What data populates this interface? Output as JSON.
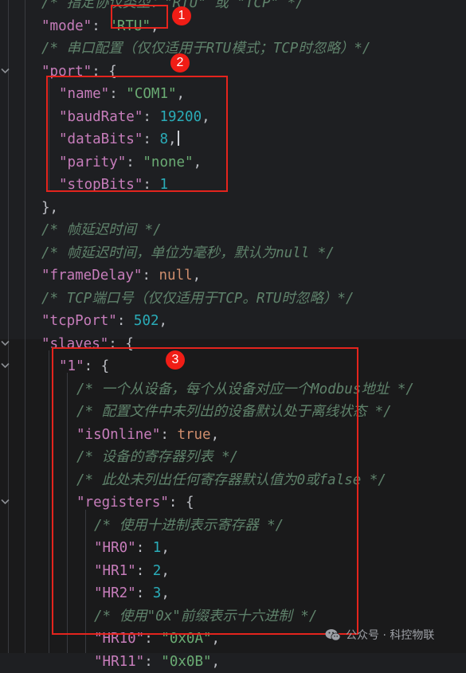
{
  "editor": {
    "lines": [
      {
        "indent": 2,
        "tokens": [
          {
            "t": "cm",
            "v": "/* 指定协议类型：\"RTU\" 或 \"TCP\" */"
          }
        ]
      },
      {
        "indent": 2,
        "tokens": [
          {
            "t": "key",
            "v": "\"mode\""
          },
          {
            "t": "p",
            "v": ": "
          },
          {
            "t": "str",
            "v": "\"RTU\""
          },
          {
            "t": "p",
            "v": ","
          }
        ]
      },
      {
        "indent": 2,
        "tokens": [
          {
            "t": "cm",
            "v": "/* 串口配置（仅仅适用于RTU模式；TCP时忽略）*/"
          }
        ]
      },
      {
        "indent": 2,
        "fold": true,
        "tokens": [
          {
            "t": "key",
            "v": "\"port\""
          },
          {
            "t": "p",
            "v": ": {"
          }
        ]
      },
      {
        "indent": 3,
        "tokens": [
          {
            "t": "key",
            "v": "\"name\""
          },
          {
            "t": "p",
            "v": ": "
          },
          {
            "t": "str",
            "v": "\"COM1\""
          },
          {
            "t": "p",
            "v": ","
          }
        ]
      },
      {
        "indent": 3,
        "tokens": [
          {
            "t": "key",
            "v": "\"baudRate\""
          },
          {
            "t": "p",
            "v": ": "
          },
          {
            "t": "num",
            "v": "19200"
          },
          {
            "t": "p",
            "v": ","
          }
        ]
      },
      {
        "indent": 3,
        "caret": true,
        "tokens": [
          {
            "t": "key",
            "v": "\"dataBits\""
          },
          {
            "t": "p",
            "v": ": "
          },
          {
            "t": "num",
            "v": "8"
          },
          {
            "t": "p",
            "v": ","
          }
        ]
      },
      {
        "indent": 3,
        "tokens": [
          {
            "t": "key",
            "v": "\"parity\""
          },
          {
            "t": "p",
            "v": ": "
          },
          {
            "t": "str",
            "v": "\"none\""
          },
          {
            "t": "p",
            "v": ","
          }
        ]
      },
      {
        "indent": 3,
        "tokens": [
          {
            "t": "key",
            "v": "\"stopBits\""
          },
          {
            "t": "p",
            "v": ": "
          },
          {
            "t": "num",
            "v": "1"
          }
        ]
      },
      {
        "indent": 2,
        "tokens": [
          {
            "t": "p",
            "v": "},"
          }
        ]
      },
      {
        "indent": 2,
        "tokens": [
          {
            "t": "cm",
            "v": "/* 帧延迟时间 */"
          }
        ]
      },
      {
        "indent": 2,
        "tokens": [
          {
            "t": "cm",
            "v": "/* 帧延迟时间，单位为毫秒，默认为null */"
          }
        ]
      },
      {
        "indent": 2,
        "tokens": [
          {
            "t": "key",
            "v": "\"frameDelay\""
          },
          {
            "t": "p",
            "v": ": "
          },
          {
            "t": "kw",
            "v": "null"
          },
          {
            "t": "p",
            "v": ","
          }
        ]
      },
      {
        "indent": 2,
        "tokens": [
          {
            "t": "cm",
            "v": "/* TCP端口号（仅仅适用于TCP。RTU时忽略）*/"
          }
        ]
      },
      {
        "indent": 2,
        "tokens": [
          {
            "t": "key",
            "v": "\"tcpPort\""
          },
          {
            "t": "p",
            "v": ": "
          },
          {
            "t": "num",
            "v": "502"
          },
          {
            "t": "p",
            "v": ","
          }
        ]
      },
      {
        "indent": 2,
        "fold": true,
        "tokens": [
          {
            "t": "key",
            "v": "\"slaves\""
          },
          {
            "t": "p",
            "v": ": {"
          }
        ]
      },
      {
        "indent": 3,
        "fold": true,
        "tokens": [
          {
            "t": "key",
            "v": "\"1\""
          },
          {
            "t": "p",
            "v": ": {"
          }
        ]
      },
      {
        "indent": 4,
        "tokens": [
          {
            "t": "cm",
            "v": "/* 一个从设备，每个从设备对应一个Modbus地址 */"
          }
        ]
      },
      {
        "indent": 4,
        "tokens": [
          {
            "t": "cm",
            "v": "/* 配置文件中未列出的设备默认处于离线状态 */"
          }
        ]
      },
      {
        "indent": 4,
        "tokens": [
          {
            "t": "key",
            "v": "\"isOnline\""
          },
          {
            "t": "p",
            "v": ": "
          },
          {
            "t": "kw",
            "v": "true"
          },
          {
            "t": "p",
            "v": ","
          }
        ]
      },
      {
        "indent": 4,
        "tokens": [
          {
            "t": "cm",
            "v": "/* 设备的寄存器列表 */"
          }
        ]
      },
      {
        "indent": 4,
        "tokens": [
          {
            "t": "cm",
            "v": "/* 此处未列出任何寄存器默认值为0或false */"
          }
        ]
      },
      {
        "indent": 4,
        "fold": true,
        "tokens": [
          {
            "t": "key",
            "v": "\"registers\""
          },
          {
            "t": "p",
            "v": ": {"
          }
        ]
      },
      {
        "indent": 5,
        "tokens": [
          {
            "t": "cm",
            "v": "/* 使用十进制表示寄存器 */"
          }
        ]
      },
      {
        "indent": 5,
        "tokens": [
          {
            "t": "key",
            "v": "\"HR0\""
          },
          {
            "t": "p",
            "v": ": "
          },
          {
            "t": "num",
            "v": "1"
          },
          {
            "t": "p",
            "v": ","
          }
        ]
      },
      {
        "indent": 5,
        "tokens": [
          {
            "t": "key",
            "v": "\"HR1\""
          },
          {
            "t": "p",
            "v": ": "
          },
          {
            "t": "num",
            "v": "2"
          },
          {
            "t": "p",
            "v": ","
          }
        ]
      },
      {
        "indent": 5,
        "tokens": [
          {
            "t": "key",
            "v": "\"HR2\""
          },
          {
            "t": "p",
            "v": ": "
          },
          {
            "t": "num",
            "v": "3"
          },
          {
            "t": "p",
            "v": ","
          }
        ]
      },
      {
        "indent": 5,
        "tokens": [
          {
            "t": "cm",
            "v": "/* 使用\"0x\"前缀表示十六进制 */"
          }
        ]
      },
      {
        "indent": 5,
        "tokens": [
          {
            "t": "key",
            "v": "\"HR10\""
          },
          {
            "t": "p",
            "v": ": "
          },
          {
            "t": "str",
            "v": "\"0x0A\""
          },
          {
            "t": "p",
            "v": ","
          }
        ]
      },
      {
        "indent": 5,
        "tokens": [
          {
            "t": "key",
            "v": "\"HR11\""
          },
          {
            "t": "p",
            "v": ": "
          },
          {
            "t": "str",
            "v": "\"0x0B\""
          },
          {
            "t": "p",
            "v": ","
          }
        ]
      }
    ]
  },
  "annotations": [
    "1",
    "2",
    "3"
  ],
  "watermark": {
    "text": "公众号 · 科控物联",
    "icon": "wechat-icon"
  },
  "colors": {
    "background": "#1e1f22",
    "highlighted_block": "#1a1a1b",
    "key": "#c77dbb",
    "string": "#6aab73",
    "number": "#2aacb8",
    "keyword": "#cf8e6d",
    "comment": "#5f826b",
    "annotation_red": "#e4241d"
  }
}
